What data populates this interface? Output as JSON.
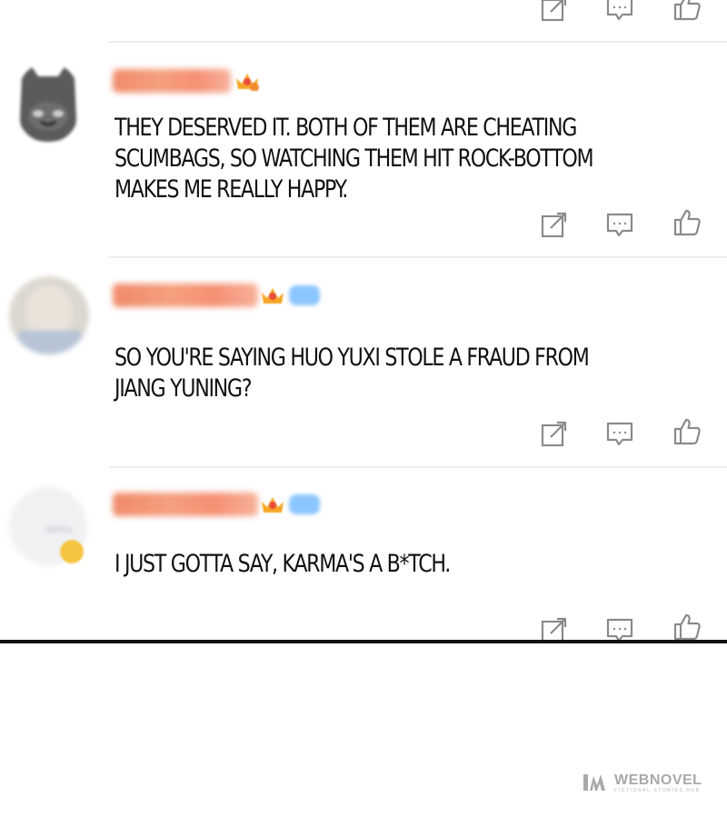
{
  "comments": [
    {
      "text_lines": [
        "THEY DESERVED IT. BOTH OF THEM ARE CHEATING",
        "SCUMBAGS, SO WATCHING THEM HIT ROCK-BOTTOM",
        "MAKES ME REALLY HAPPY."
      ]
    },
    {
      "text_lines": [
        "SO YOU'RE SAYING HUO YUXI STOLE A FRAUD FROM",
        "JIANG YUNING?"
      ]
    },
    {
      "text_lines": [
        "I JUST GOTTA SAY, KARMA'S A B*TCH."
      ]
    }
  ],
  "action_icons": [
    "share-icon",
    "reply-icon",
    "like-icon"
  ],
  "watermark": {
    "name": "WEBNOVEL",
    "tagline": "FICTIONAL STORIES HUB"
  },
  "colors": {
    "text": "#111111",
    "icon": "#888888",
    "divider": "#eeeeee",
    "border": "#111111"
  }
}
